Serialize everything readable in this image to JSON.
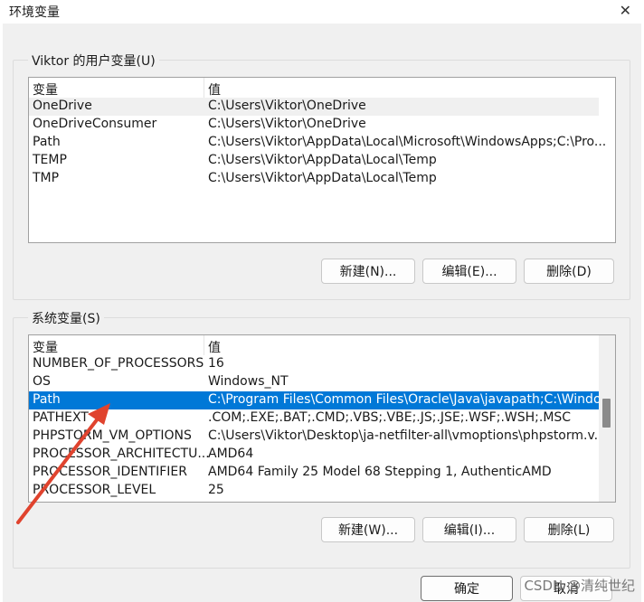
{
  "window": {
    "title": "环境变量",
    "close_icon": "close-icon"
  },
  "user_vars": {
    "group_label": "Viktor 的用户变量(U)",
    "col_name": "变量",
    "col_value": "值",
    "rows": [
      {
        "name": "OneDrive",
        "value": "C:\\Users\\Viktor\\OneDrive"
      },
      {
        "name": "OneDriveConsumer",
        "value": "C:\\Users\\Viktor\\OneDrive"
      },
      {
        "name": "Path",
        "value": "C:\\Users\\Viktor\\AppData\\Local\\Microsoft\\WindowsApps;C:\\Pro..."
      },
      {
        "name": "TEMP",
        "value": "C:\\Users\\Viktor\\AppData\\Local\\Temp"
      },
      {
        "name": "TMP",
        "value": "C:\\Users\\Viktor\\AppData\\Local\\Temp"
      }
    ],
    "buttons": {
      "new": "新建(N)...",
      "edit": "编辑(E)...",
      "delete": "删除(D)"
    }
  },
  "system_vars": {
    "group_label": "系统变量(S)",
    "col_name": "变量",
    "col_value": "值",
    "rows": [
      {
        "name": "NUMBER_OF_PROCESSORS",
        "value": "16"
      },
      {
        "name": "OS",
        "value": "Windows_NT"
      },
      {
        "name": "Path",
        "value": "C:\\Program Files\\Common Files\\Oracle\\Java\\javapath;C:\\Windo..."
      },
      {
        "name": "PATHEXT",
        "value": ".COM;.EXE;.BAT;.CMD;.VBS;.VBE;.JS;.JSE;.WSF;.WSH;.MSC"
      },
      {
        "name": "PHPSTORM_VM_OPTIONS",
        "value": "C:\\Users\\Viktor\\Desktop\\ja-netfilter-all\\vmoptions\\phpstorm.v..."
      },
      {
        "name": "PROCESSOR_ARCHITECTU...",
        "value": "AMD64"
      },
      {
        "name": "PROCESSOR_IDENTIFIER",
        "value": "AMD64 Family 25 Model 68 Stepping 1, AuthenticAMD"
      },
      {
        "name": "PROCESSOR_LEVEL",
        "value": "25"
      }
    ],
    "selected_row": "Path",
    "buttons": {
      "new": "新建(W)...",
      "edit": "编辑(I)...",
      "delete": "删除(L)"
    }
  },
  "footer": {
    "ok": "确定",
    "cancel": "取消"
  },
  "watermark": "CSDN @清纯世纪",
  "colors": {
    "selection": "#0078d7",
    "arrow": "#e0432e"
  }
}
